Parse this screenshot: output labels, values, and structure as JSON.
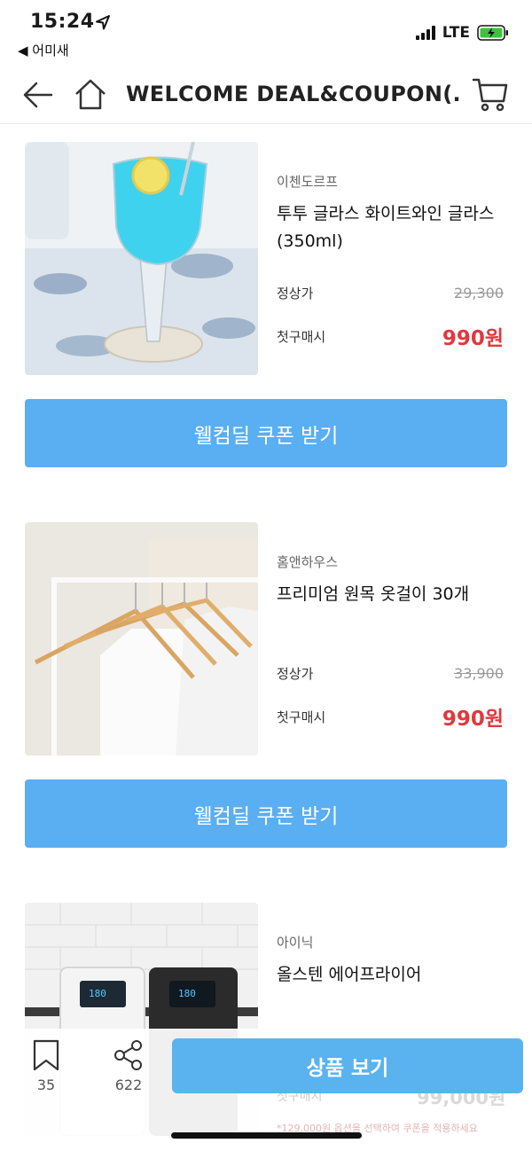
{
  "status": {
    "time": "15:24",
    "back_app": "◀ 어미새",
    "network": "LTE"
  },
  "nav": {
    "title": "WELCOME DEAL&COUPON(..."
  },
  "products": [
    {
      "brand": "이첸도르프",
      "name": "투투 글라스 화이트와인 글라스(350ml)",
      "regular_label": "정상가",
      "regular_price": "29,300",
      "first_label": "첫구매시",
      "sale_price": "990원",
      "coupon_button": "웰컴딜 쿠폰 받기"
    },
    {
      "brand": "홈앤하우스",
      "name": "프리미엄 원목 옷걸이 30개",
      "regular_label": "정상가",
      "regular_price": "33,900",
      "first_label": "첫구매시",
      "sale_price": "990원",
      "coupon_button": "웰컴딜 쿠폰 받기"
    },
    {
      "brand": "아이닉",
      "name": "올스텐 에어프라이어",
      "first_label": "첫구매시",
      "sale_price": "99,000원",
      "note": "*129,000원 옵션을 선택하여 쿠폰을 적용하세요",
      "screen_value": "180"
    }
  ],
  "bottom": {
    "bookmark_count": "35",
    "share_count": "622",
    "view_button": "상품 보기"
  },
  "colors": {
    "accent_blue": "#5aaef2",
    "sale_red": "#e0393e"
  },
  "icons": [
    "location-arrow-icon",
    "signal-icon",
    "battery-charging-icon",
    "back-arrow-icon",
    "home-icon",
    "cart-icon",
    "bookmark-icon",
    "share-icon"
  ]
}
